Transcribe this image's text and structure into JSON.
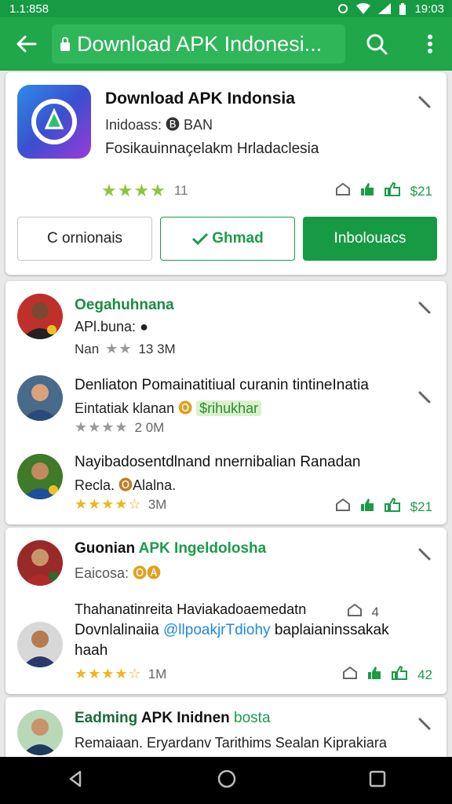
{
  "status": {
    "time_left": "1.1:858",
    "time_right": "19:03"
  },
  "app_bar": {
    "url_title": "Download APK Indonesi..."
  },
  "app_card": {
    "title": "Download APK Indonsia",
    "subtitle": "Inidoass: 🅑 BAN",
    "description": "Fosikauinnaçelakm Hrladaclesia",
    "rating_count": "11",
    "thumb_count": "$21",
    "buttons": {
      "left": "C ornionais",
      "middle": "Ghmad",
      "right": "Inbolouacs"
    }
  },
  "feed": [
    {
      "title": "Oegahuhnana",
      "subtitle": "APl.buna:",
      "meta": "Nan",
      "count": "13 3M"
    },
    {
      "title": "Denliaton Pomainatitiual curanin tintineInatia",
      "subtitle_a": "Eintatiak klanan",
      "subtitle_b": "$rihukhar",
      "count": "2 0M"
    },
    {
      "title": "Nayibadosentdlnand nnernibalian Ranadan",
      "subtitle": "Recla.",
      "subtitle_b": "Alalna.",
      "count": "3M",
      "thumb_count": "$21"
    }
  ],
  "feed2": [
    {
      "title_a": "Guonian",
      "title_b": "APK Ingeldolosha",
      "subtitle": "Eaicosa:",
      "description": "Thahanatinreita Haviakadoaemedatn",
      "share_count": "4"
    },
    {
      "title_a": "Dovnlalinaiia",
      "title_link": "@llpoakjrTdiohy",
      "title_b": "baplaianinssakak",
      "title_line2": "haah",
      "count": "1M",
      "thumb_count": "42"
    }
  ],
  "feed3": {
    "title_a": "Eadming",
    "title_b": "APK Inidnen",
    "title_c": "bosta",
    "subtitle": "Remaiaan. Eryardanv Tarithims Sealan Kiprakiara"
  },
  "colors": {
    "status_bar": "#169a43",
    "app_bar": "#1fa749",
    "accent": "#1a9c48",
    "star_green": "#8fc43f",
    "star_gold": "#f0b61c"
  }
}
